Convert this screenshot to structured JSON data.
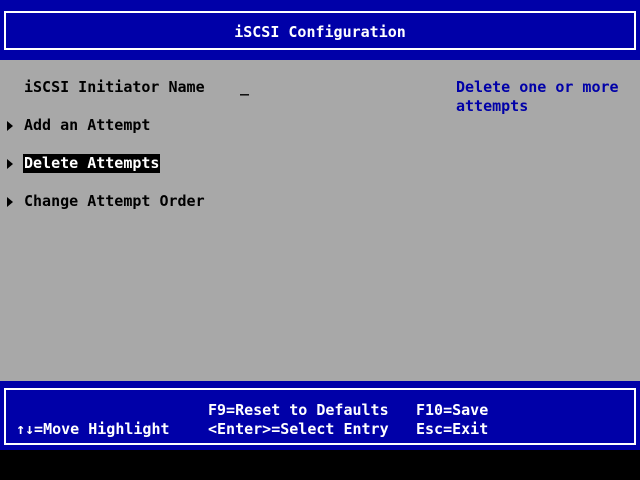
{
  "header": {
    "title": "iSCSI Configuration"
  },
  "form": {
    "initiator_name_label": "iSCSI Initiator Name",
    "initiator_name_value": "_",
    "items": [
      {
        "label": "Add an Attempt",
        "icon": "arrow-right-icon",
        "selected": false
      },
      {
        "label": "Delete Attempts",
        "icon": "arrow-right-icon",
        "selected": true
      },
      {
        "label": "Change Attempt Order",
        "icon": "arrow-right-icon",
        "selected": false
      }
    ]
  },
  "help": {
    "text": "Delete one or more attempts"
  },
  "footer": {
    "move_highlight": "↑↓=Move Highlight",
    "reset_defaults": "F9=Reset to Defaults",
    "select_entry": "<Enter>=Select Entry",
    "save": "F10=Save",
    "exit": "Esc=Exit"
  },
  "colors": {
    "band": "#0000a8",
    "body": "#a8a8a8",
    "help_text": "#0000a8",
    "highlight_bg": "#000000",
    "highlight_fg": "#ffffff"
  }
}
